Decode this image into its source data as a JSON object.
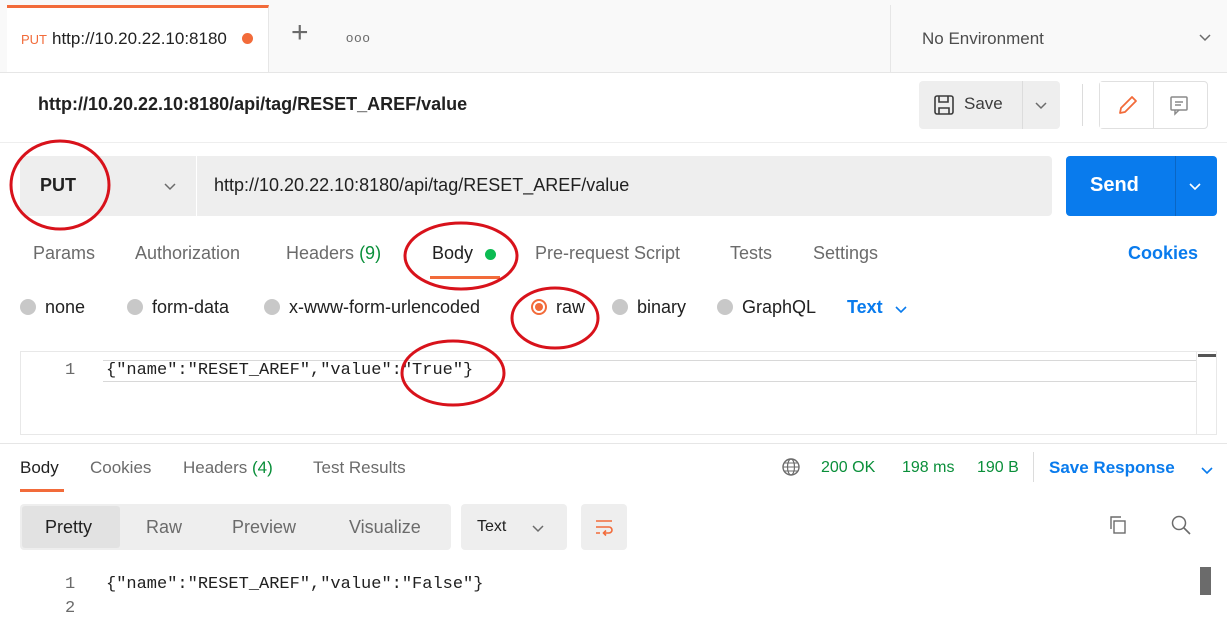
{
  "tab": {
    "method": "PUT",
    "url": "http://10.20.22.10:8180"
  },
  "environment": {
    "label": "No Environment"
  },
  "request": {
    "title": "http://10.20.22.10:8180/api/tag/RESET_AREF/value",
    "method": "PUT",
    "url": "http://10.20.22.10:8180/api/tag/RESET_AREF/value",
    "save_label": "Save",
    "send_label": "Send"
  },
  "request_tabs": {
    "params": "Params",
    "authorization": "Authorization",
    "headers": "Headers",
    "headers_count": "(9)",
    "body": "Body",
    "prerequest": "Pre-request Script",
    "tests": "Tests",
    "settings": "Settings",
    "cookies": "Cookies"
  },
  "body_types": {
    "none": "none",
    "form_data": "form-data",
    "urlencoded": "x-www-form-urlencoded",
    "raw": "raw",
    "binary": "binary",
    "graphql": "GraphQL",
    "selected": "raw",
    "format": "Text"
  },
  "request_body": {
    "line_number": "1",
    "code": "{\"name\":\"RESET_AREF\",\"value\":\"True\"}"
  },
  "response": {
    "tabs": {
      "body": "Body",
      "cookies": "Cookies",
      "headers": "Headers",
      "headers_count": "(4)",
      "test_results": "Test Results"
    },
    "status": "200 OK",
    "time": "198 ms",
    "size": "190 B",
    "save_response": "Save Response",
    "views": {
      "pretty": "Pretty",
      "raw": "Raw",
      "preview": "Preview",
      "visualize": "Visualize"
    },
    "format": "Text",
    "lines": [
      {
        "num": "1",
        "code": "{\"name\":\"RESET_AREF\",\"value\":\"False\"}"
      },
      {
        "num": "2",
        "code": ""
      }
    ]
  },
  "colors": {
    "accent": "#f26b3a",
    "primary": "#097bed",
    "success": "#0a8f3a",
    "annotation": "#d8121b"
  },
  "icons": [
    "plus-icon",
    "more-icon",
    "chevron-down-icon",
    "save-icon",
    "pencil-icon",
    "comment-icon",
    "globe-icon",
    "wrap-icon",
    "copy-icon",
    "search-icon"
  ]
}
